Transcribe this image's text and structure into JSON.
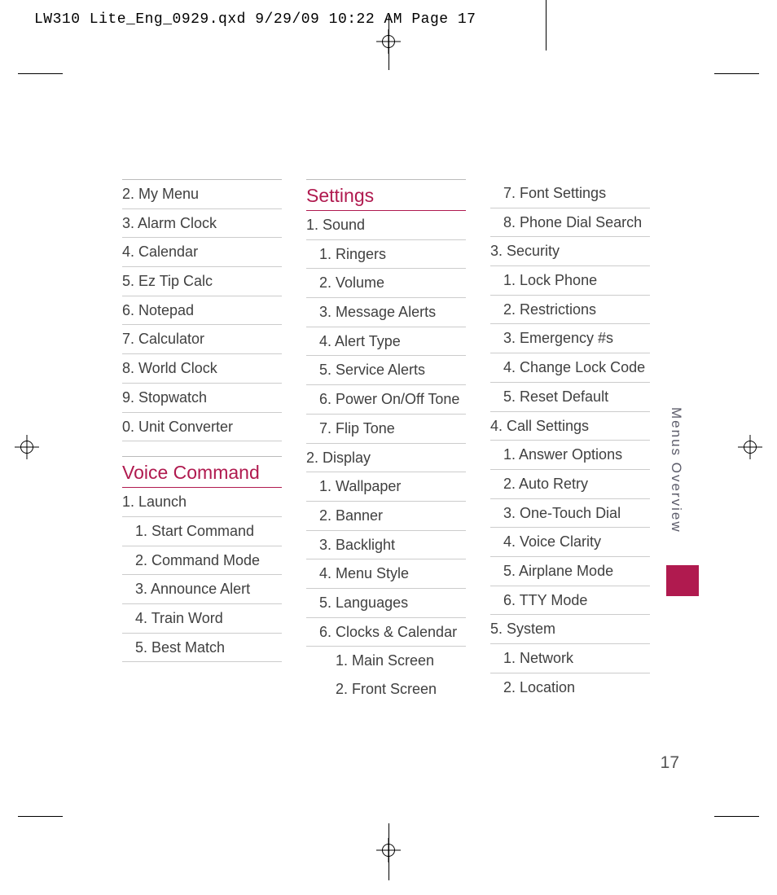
{
  "slug": "LW310 Lite_Eng_0929.qxd  9/29/09  10:22 AM  Page 17",
  "side_tab": "Menus Overview",
  "page_number": "17",
  "col1": {
    "items": [
      "2. My Menu",
      "3. Alarm Clock",
      "4. Calendar",
      "5. Ez Tip Calc",
      "6. Notepad",
      "7. Calculator",
      "8. World Clock",
      "9. Stopwatch",
      "0. Unit Converter"
    ],
    "section_head": "Voice Command",
    "launch_label": "1. Launch",
    "launch_items": [
      "1. Start Command",
      "2. Command Mode",
      "3. Announce Alert",
      "4. Train Word",
      "5. Best Match"
    ]
  },
  "col2": {
    "section_head": "Settings",
    "items": [
      {
        "t": "1. Sound",
        "lvl": 0
      },
      {
        "t": "1. Ringers",
        "lvl": 1
      },
      {
        "t": "2. Volume",
        "lvl": 1
      },
      {
        "t": "3. Message Alerts",
        "lvl": 1
      },
      {
        "t": "4. Alert Type",
        "lvl": 1
      },
      {
        "t": "5. Service Alerts",
        "lvl": 1
      },
      {
        "t": "6. Power On/Off Tone",
        "lvl": 1
      },
      {
        "t": "7. Flip Tone",
        "lvl": 1
      },
      {
        "t": "2. Display",
        "lvl": 0
      },
      {
        "t": "1. Wallpaper",
        "lvl": 1
      },
      {
        "t": "2. Banner",
        "lvl": 1
      },
      {
        "t": "3. Backlight",
        "lvl": 1
      },
      {
        "t": "4. Menu Style",
        "lvl": 1
      },
      {
        "t": "5. Languages",
        "lvl": 1
      },
      {
        "t": "6. Clocks & Calendar",
        "lvl": 1
      },
      {
        "t": "1. Main Screen",
        "lvl": 2,
        "noline": true
      },
      {
        "t": "2. Front Screen",
        "lvl": 2,
        "noline": true
      }
    ]
  },
  "col3": {
    "items": [
      {
        "t": "7. Font Settings",
        "lvl": 1
      },
      {
        "t": "8. Phone Dial Search",
        "lvl": 1
      },
      {
        "t": "3. Security",
        "lvl": 0
      },
      {
        "t": "1. Lock Phone",
        "lvl": 1
      },
      {
        "t": "2. Restrictions",
        "lvl": 1
      },
      {
        "t": "3. Emergency #s",
        "lvl": 1
      },
      {
        "t": "4. Change Lock Code",
        "lvl": 1
      },
      {
        "t": "5. Reset Default",
        "lvl": 1
      },
      {
        "t": "4. Call Settings",
        "lvl": 0
      },
      {
        "t": "1. Answer Options",
        "lvl": 1
      },
      {
        "t": "2. Auto Retry",
        "lvl": 1
      },
      {
        "t": "3. One-Touch Dial",
        "lvl": 1
      },
      {
        "t": "4. Voice Clarity",
        "lvl": 1
      },
      {
        "t": "5. Airplane Mode",
        "lvl": 1
      },
      {
        "t": "6. TTY Mode",
        "lvl": 1
      },
      {
        "t": "5. System",
        "lvl": 0
      },
      {
        "t": "1. Network",
        "lvl": 1
      },
      {
        "t": "2. Location",
        "lvl": 1,
        "noline": true
      }
    ]
  }
}
